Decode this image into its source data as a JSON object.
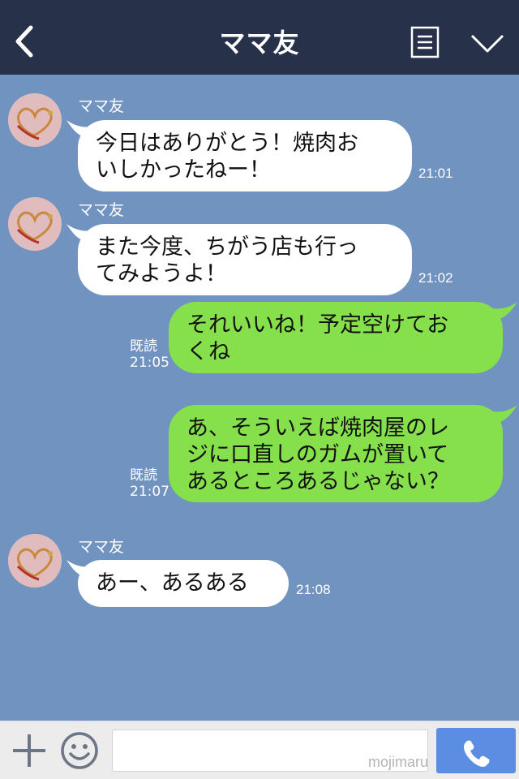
{
  "header": {
    "title": "ママ友",
    "back_icon": "chevron-left-icon",
    "menu_icon": "list-icon",
    "expand_icon": "chevron-down-icon"
  },
  "messages": [
    {
      "direction": "in",
      "sender": "ママ友",
      "lines": [
        "今日はありがとう！焼肉お",
        "いしかったねー！"
      ],
      "time": "21:01"
    },
    {
      "direction": "in",
      "sender": "ママ友",
      "lines": [
        "また今度、ちがう店も行っ",
        "てみようよ！"
      ],
      "time": "21:02"
    },
    {
      "direction": "out",
      "read": "既読",
      "lines": [
        "それいいね！予定空けてお",
        "くね"
      ],
      "time": "21:05"
    },
    {
      "direction": "out",
      "read": "既読",
      "lines": [
        "あ、そういえば焼肉屋のレ",
        "ジに口直しのガムが置いて",
        "あるところあるじゃない？"
      ],
      "time": "21:07"
    },
    {
      "direction": "in",
      "sender": "ママ友",
      "lines": [
        "あー、あるある"
      ],
      "time": "21:08"
    }
  ],
  "footer": {
    "input_value": "",
    "watermark": "mojimaru",
    "plus_icon": "plus-icon",
    "emoji_icon": "smiley-icon",
    "call_icon": "phone-icon"
  },
  "colors": {
    "header_bg": "#27314a",
    "chat_bg": "#7093c0",
    "incoming_bubble": "#ffffff",
    "outgoing_bubble": "#86e04c",
    "call_button": "#5b8ee2"
  }
}
